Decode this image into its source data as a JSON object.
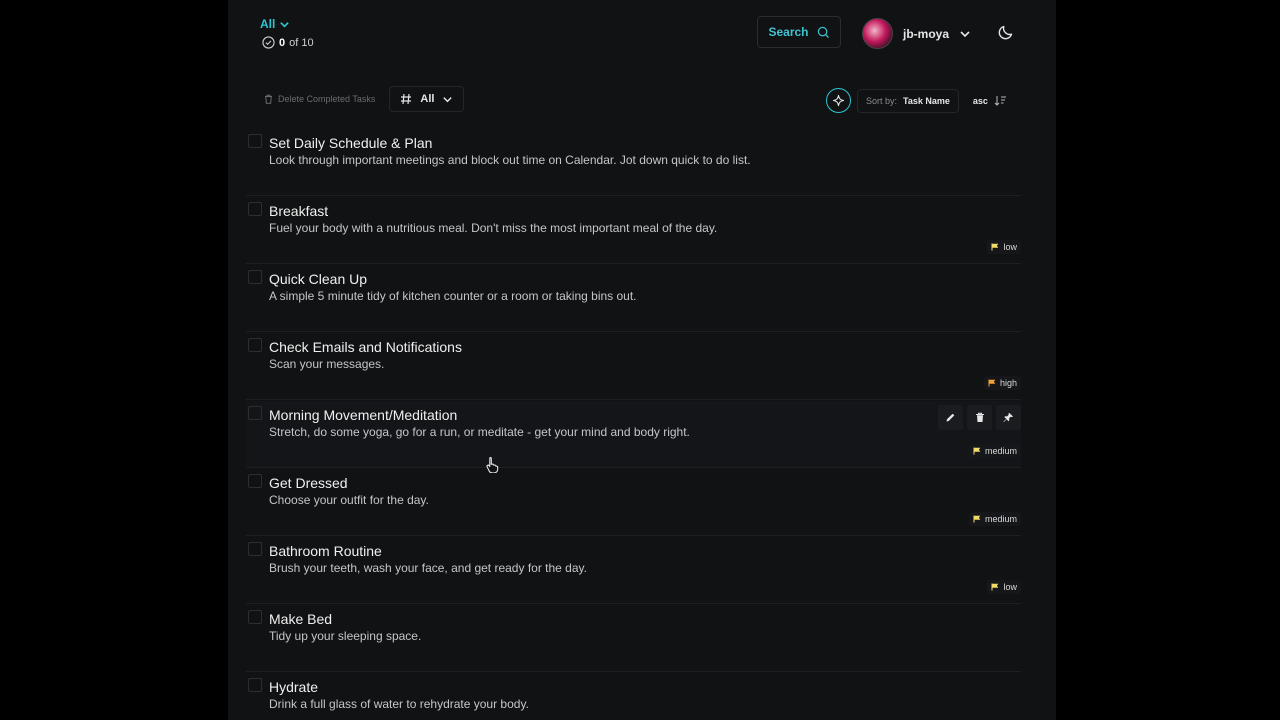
{
  "header": {
    "filter_label": "All",
    "progress": {
      "done": "0",
      "rest": "of 10"
    },
    "search_label": "Search",
    "username": "jb-moya"
  },
  "toolbar": {
    "delete_completed_label": "Delete Completed Tasks",
    "tag_filter_label": "All",
    "sort_by_label": "Sort by:",
    "sort_field": "Task Name",
    "sort_order": "asc"
  },
  "tasks": [
    {
      "title": "Set Daily Schedule & Plan",
      "description": "Look through important meetings and block out time on Calendar. Jot down quick to do list.",
      "priority": ""
    },
    {
      "title": "Breakfast",
      "description": "Fuel your body with a nutritious meal. Don't miss the most important meal of the day.",
      "priority": "low"
    },
    {
      "title": "Quick Clean Up",
      "description": "A simple 5 minute tidy of kitchen counter or a room or taking bins out.",
      "priority": ""
    },
    {
      "title": "Check Emails and Notifications",
      "description": "Scan your messages.",
      "priority": "high"
    },
    {
      "title": "Morning Movement/Meditation",
      "description": "Stretch, do some yoga, go for a run, or meditate - get your mind and body right.",
      "priority": "medium"
    },
    {
      "title": "Get Dressed",
      "description": "Choose your outfit for the day.",
      "priority": "medium"
    },
    {
      "title": "Bathroom Routine",
      "description": "Brush your teeth, wash your face, and get ready for the day.",
      "priority": "low"
    },
    {
      "title": "Make Bed",
      "description": "Tidy up your sleeping space.",
      "priority": ""
    },
    {
      "title": "Hydrate",
      "description": "Drink a full glass of water to rehydrate your body.",
      "priority": ""
    }
  ],
  "colors": {
    "accent": "#2ec5d3",
    "background": "#111214",
    "flag_low": "#f1dc6a",
    "flag_medium": "#f1dc6a",
    "flag_high": "#f2a23a"
  }
}
